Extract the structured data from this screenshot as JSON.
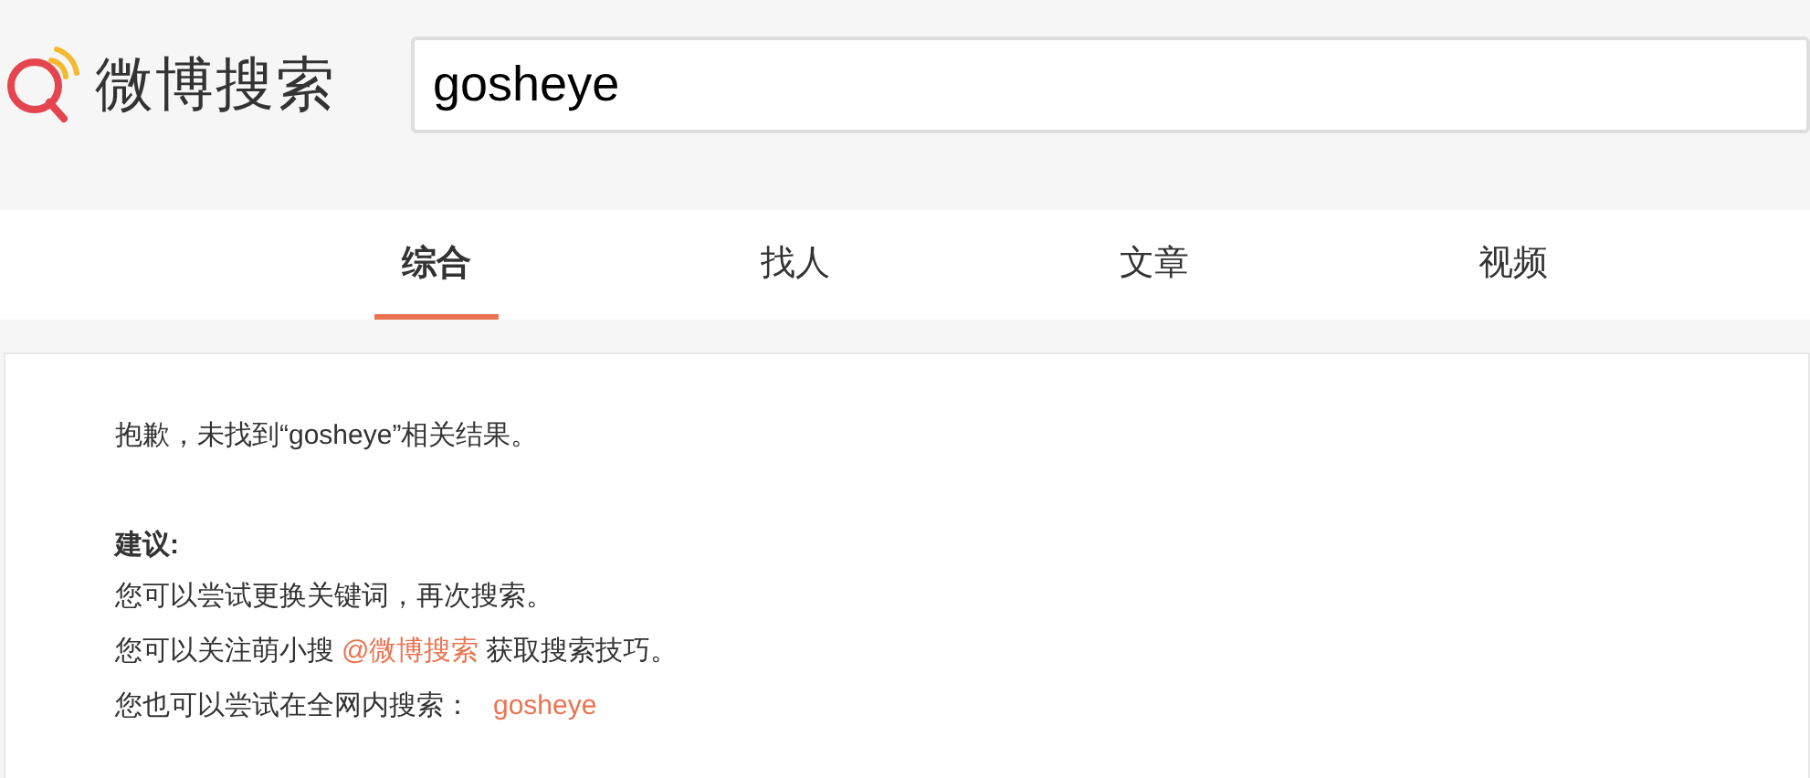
{
  "logo": {
    "text": "微博搜索"
  },
  "search": {
    "value": "gosheye"
  },
  "tabs": [
    {
      "label": "综合",
      "selected": true
    },
    {
      "label": "找人",
      "selected": false
    },
    {
      "label": "文章",
      "selected": false
    },
    {
      "label": "视频",
      "selected": false
    }
  ],
  "result": {
    "message": "抱歉，未找到“gosheye”相关结果。",
    "suggestion_heading": "建议:",
    "suggestions": [
      {
        "text": "您可以尝试更换关键词，再次搜索。"
      },
      {
        "text": "您可以关注萌小搜",
        "link": "@微博搜索",
        "after": "获取搜索技巧。"
      },
      {
        "text": "您也可以尝试在全网内搜索：",
        "link": "gosheye"
      }
    ]
  }
}
